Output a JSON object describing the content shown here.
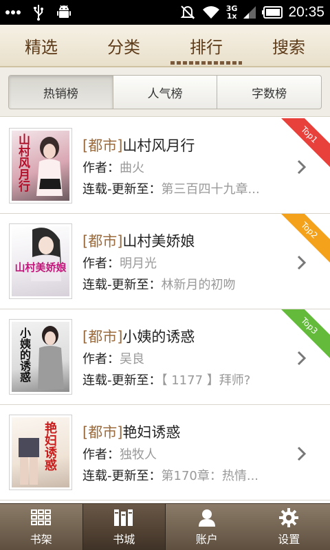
{
  "status_bar": {
    "time": "20:35",
    "network": [
      "3G",
      "1x"
    ],
    "icons": [
      "more-icon",
      "usb-icon",
      "android-icon",
      "mute-icon",
      "wifi-icon",
      "signal-icon",
      "battery-icon"
    ]
  },
  "top_tabs": [
    {
      "label": "精选",
      "active": false
    },
    {
      "label": "分类",
      "active": false
    },
    {
      "label": "排行",
      "active": true
    },
    {
      "label": "搜索",
      "active": false
    }
  ],
  "segments": [
    {
      "label": "热销榜",
      "active": true
    },
    {
      "label": "人气榜",
      "active": false
    },
    {
      "label": "字数榜",
      "active": false
    }
  ],
  "labels": {
    "author_prefix": "作者：",
    "update_prefix": "连载-更新至："
  },
  "books": [
    {
      "category": "都市",
      "title": "山村风月行",
      "author": "曲火",
      "update": "第三百四十九章...",
      "rank": "Top1",
      "rank_color": "#e8413c",
      "cover_text": "山村风月行"
    },
    {
      "category": "都市",
      "title": "山村美娇娘",
      "author": "明月光",
      "update": "林新月的初吻",
      "rank": "Top2",
      "rank_color": "#f4a21b",
      "cover_text": "山村美娇娘"
    },
    {
      "category": "都市",
      "title": "小姨的诱惑",
      "author": "吴良",
      "update": "【 1177 】拜师?",
      "rank": "Top3",
      "rank_color": "#64bb3b",
      "cover_text": "小姨的诱惑"
    },
    {
      "category": "都市",
      "title": "艳妇诱惑",
      "author": "独牧人",
      "update": "第170章：热情...",
      "rank": "",
      "rank_color": "",
      "cover_text": "艳妇诱惑"
    }
  ],
  "bottom_nav": [
    {
      "label": "书架",
      "icon": "bookshelf-grid-icon",
      "active": false
    },
    {
      "label": "书城",
      "icon": "bookstore-icon",
      "active": true
    },
    {
      "label": "账户",
      "icon": "user-icon",
      "active": false
    },
    {
      "label": "设置",
      "icon": "gear-icon",
      "active": false
    }
  ]
}
